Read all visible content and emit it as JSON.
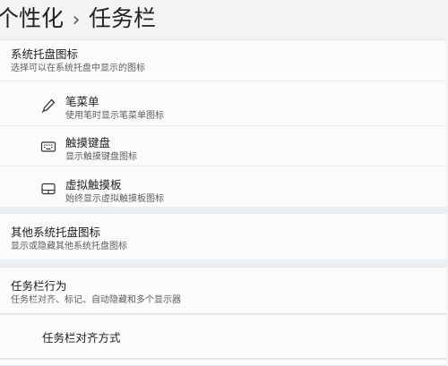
{
  "header": {
    "parent": "个性化",
    "separator": "›",
    "title": "任务栏"
  },
  "tray_icons": {
    "title": "系统托盘图标",
    "description": "选择可以在系统托盘中显示的图标",
    "items": [
      {
        "icon": "pen-icon",
        "label": "笔菜单",
        "description": "使用笔时显示笔菜单图标"
      },
      {
        "icon": "keyboard-icon",
        "label": "触摸键盘",
        "description": "显示触摸键盘图标"
      },
      {
        "icon": "touchpad-icon",
        "label": "虚拟触摸板",
        "description": "始终显示虚拟触摸板图标"
      }
    ]
  },
  "other_tray": {
    "title": "其他系统托盘图标",
    "description": "显示或隐藏其他系统托盘图标"
  },
  "behaviors": {
    "title": "任务栏行为",
    "description": "任务栏对齐、标记、自动隐藏和多个显示器"
  },
  "alignment": {
    "label": "任务栏对齐方式"
  }
}
